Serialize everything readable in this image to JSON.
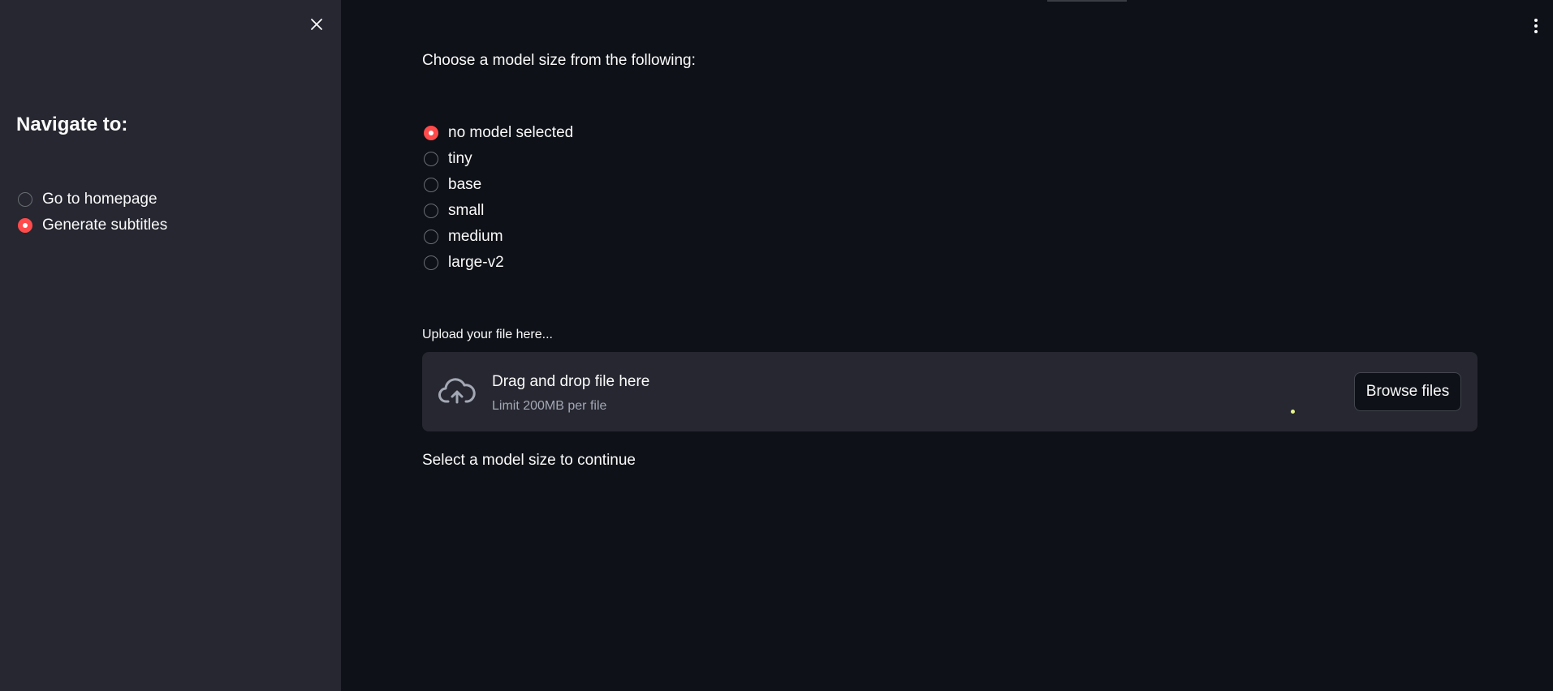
{
  "sidebar": {
    "close_icon": "close-icon",
    "title": "Navigate to:",
    "nav_options": [
      {
        "label": "Go to homepage",
        "selected": false
      },
      {
        "label": "Generate subtitles",
        "selected": true
      }
    ]
  },
  "main": {
    "menu_icon": "vertical-ellipsis-icon",
    "model_prompt": "Choose a model size from the following:",
    "model_options": [
      {
        "label": "no model selected",
        "selected": true
      },
      {
        "label": "tiny",
        "selected": false
      },
      {
        "label": "base",
        "selected": false
      },
      {
        "label": "small",
        "selected": false
      },
      {
        "label": "medium",
        "selected": false
      },
      {
        "label": "large-v2",
        "selected": false
      }
    ],
    "uploader": {
      "label": "Upload your file here...",
      "icon": "cloud-upload-icon",
      "drop_title": "Drag and drop file here",
      "limit_text": "Limit 200MB per file",
      "browse_label": "Browse files"
    },
    "status_text": "Select a model size to continue"
  },
  "colors": {
    "background": "#0e1117",
    "sidebar_background": "#262730",
    "accent": "#ff4b4b",
    "text": "#fafafa",
    "muted_text": "#a3a8b4"
  }
}
